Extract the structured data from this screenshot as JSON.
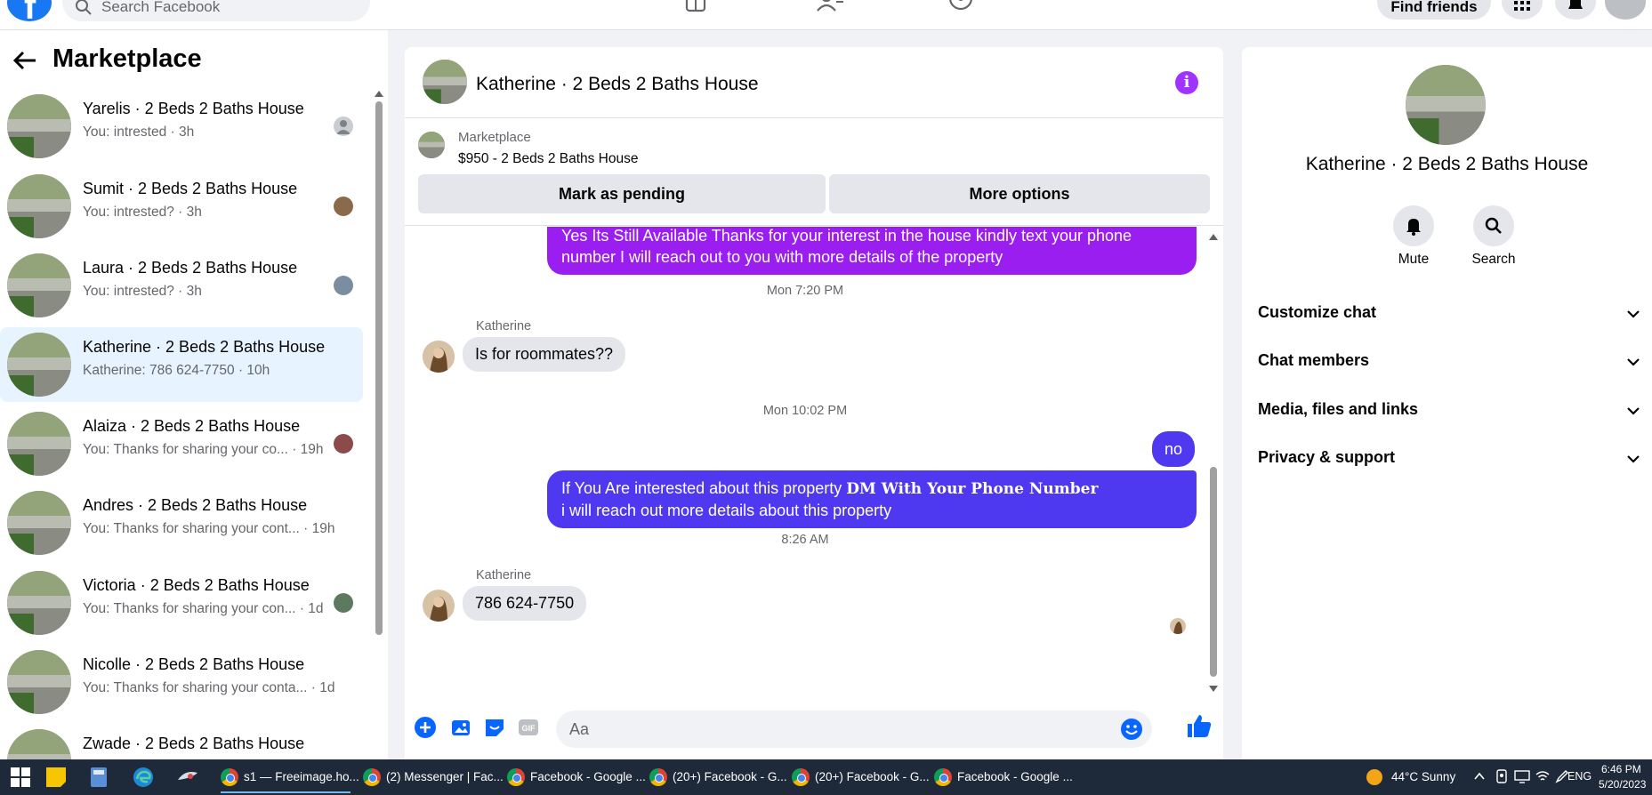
{
  "topbar": {
    "logo": "f",
    "search_placeholder": "Search Facebook",
    "find_friends": "Find friends",
    "icons": [
      "home-icon",
      "friends-icon",
      "groups-icon",
      "menu-grid-icon",
      "notifications-icon"
    ]
  },
  "sidebar": {
    "title": "Marketplace",
    "conversations": [
      {
        "name": "Yarelis · 2 Beds 2 Baths House",
        "preview": "You: intrested · 3h"
      },
      {
        "name": "Sumit · 2 Beds 2 Baths House",
        "preview": "You: intrested? · 3h"
      },
      {
        "name": "Laura · 2 Beds 2 Baths House",
        "preview": "You: intrested? · 3h"
      },
      {
        "name": "Katherine · 2 Beds 2 Baths House",
        "preview": "Katherine: 786 624-7750 · 10h"
      },
      {
        "name": "Alaiza · 2 Beds 2 Baths House",
        "preview": "You: Thanks for sharing your co... · 19h"
      },
      {
        "name": "Andres · 2 Beds 2 Baths House",
        "preview": "You: Thanks for sharing your cont... · 19h"
      },
      {
        "name": "Victoria · 2 Beds 2 Baths House",
        "preview": "You: Thanks for sharing your con... · 1d"
      },
      {
        "name": "Nicolle · 2 Beds 2 Baths House",
        "preview": "You: Thanks for sharing your conta... · 1d"
      },
      {
        "name": "Zwade · 2 Beds 2 Baths House",
        "preview": ""
      }
    ]
  },
  "chat": {
    "title": "Katherine · 2 Beds 2 Baths House",
    "info_glyph": "i",
    "marketplace_label": "Marketplace",
    "listing": "$950 - 2 Beds 2 Baths House",
    "mark_pending": "Mark as pending",
    "more_options": "More options",
    "messages": {
      "out1": "Yes Its Still Available Thanks for your interest in the house kindly text your phone number I will reach out to you with more details of the property",
      "ts1": "Mon 7:20 PM",
      "sender1": "Katherine",
      "in1": "Is for roommates??",
      "ts2": "Mon 10:02 PM",
      "out2": "no",
      "out3_a": "If You Are interested about this property ",
      "out3_bold": "DM With Your Phone Number",
      "out3_b": "i will reach out more details about this property",
      "ts3": "8:26 AM",
      "sender2": "Katherine",
      "in2": "786 624-7750"
    },
    "composer_placeholder": "Aa",
    "colors": {
      "accent": "#a033ff",
      "out_purple": "#9b1ef0",
      "out_blue": "#4e39f0"
    }
  },
  "right_panel": {
    "name": "Katherine · 2 Beds 2 Baths House",
    "mute": "Mute",
    "search": "Search",
    "sections": [
      "Customize chat",
      "Chat members",
      "Media, files and links",
      "Privacy & support"
    ]
  },
  "taskbar": {
    "apps": [
      "s1 — Freeimage.ho...",
      "(2) Messenger | Fac...",
      "Facebook - Google ...",
      "(20+) Facebook - G...",
      "(20+) Facebook - G...",
      "Facebook - Google ..."
    ],
    "weather": "44°C  Sunny",
    "lang": "ENG",
    "time": "6:46 PM",
    "date": "5/20/2023"
  }
}
